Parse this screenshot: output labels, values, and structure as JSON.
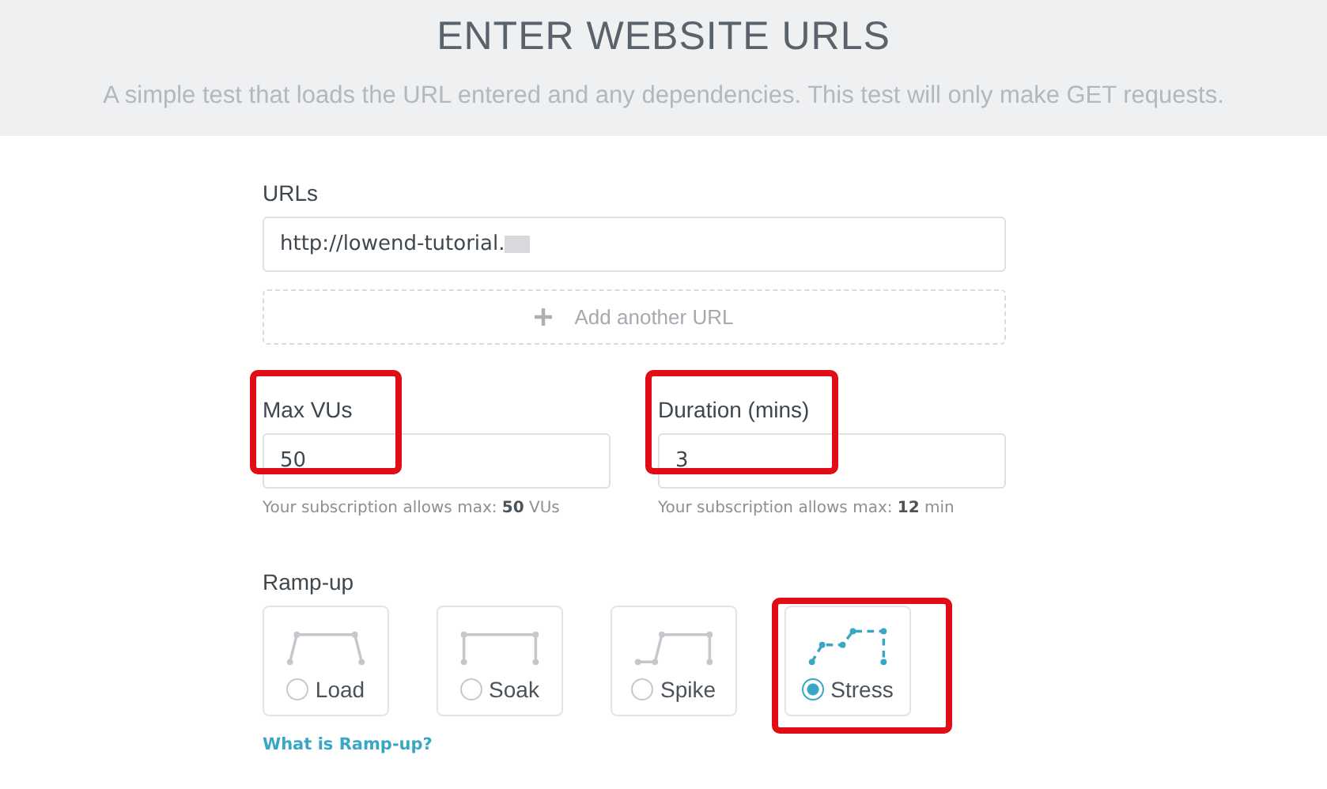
{
  "header": {
    "title": "ENTER WEBSITE URLS",
    "subtitle": "A simple test that loads the URL entered and any dependencies. This test will only make GET requests."
  },
  "urls": {
    "label": "URLs",
    "values": [
      {
        "value": "http://lowend-tutorial.",
        "redacted": true
      }
    ],
    "add_button": "Add another URL"
  },
  "fields": [
    {
      "label": "Max VUs",
      "value": "50",
      "hint": "Your subscription allows max: **50** VUs",
      "highlighted": true
    },
    {
      "label": "Duration (mins)",
      "value": "3",
      "hint": "Your subscription allows max: **12** min",
      "highlighted": true
    }
  ],
  "ramp_up": {
    "label": "Ramp-up",
    "options": [
      {
        "kind": "load",
        "label": "Load",
        "selected": false,
        "highlighted": false
      },
      {
        "kind": "soak",
        "label": "Soak",
        "selected": false,
        "highlighted": false
      },
      {
        "kind": "spike",
        "label": "Spike",
        "selected": false,
        "highlighted": false
      },
      {
        "kind": "stress",
        "label": "Stress",
        "selected": true,
        "highlighted": true
      }
    ],
    "help_link": "What is Ramp-up?"
  }
}
